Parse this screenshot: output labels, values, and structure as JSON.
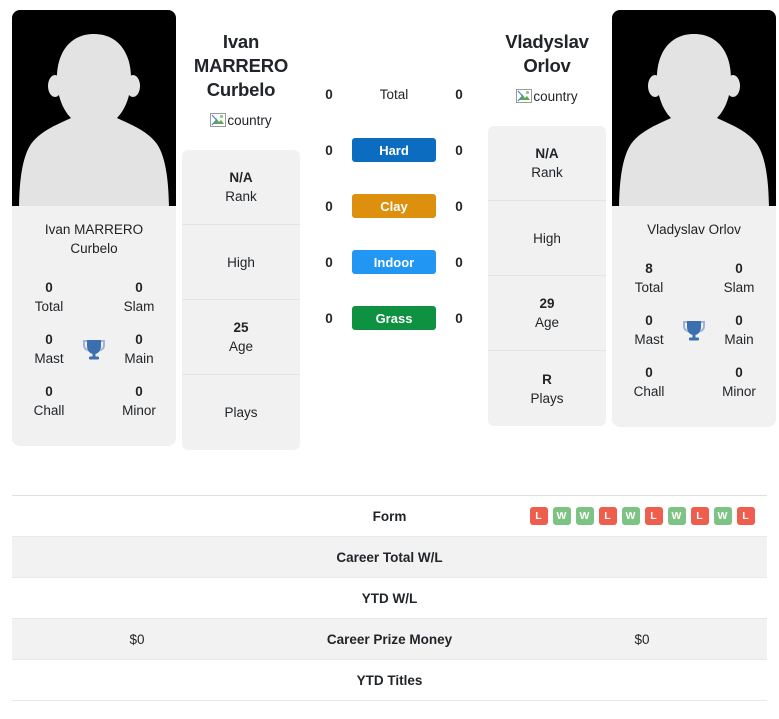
{
  "players": [
    {
      "id": "left",
      "name_line1": "Ivan MARRERO",
      "name_line2": "Curbelo",
      "photo_caption_line1": "Ivan MARRERO",
      "photo_caption_line2": "Curbelo",
      "country_alt": "country",
      "titles": {
        "total_value": "0",
        "total_label": "Total",
        "slam_value": "0",
        "slam_label": "Slam",
        "mast_value": "0",
        "mast_label": "Mast",
        "main_value": "0",
        "main_label": "Main",
        "chall_value": "0",
        "chall_label": "Chall",
        "minor_value": "0",
        "minor_label": "Minor",
        "trophy_icon": "trophy-icon"
      },
      "info": [
        {
          "value": "N/A",
          "label": "Rank"
        },
        {
          "value": "",
          "label": "High"
        },
        {
          "value": "25",
          "label": "Age"
        },
        {
          "value": "",
          "label": "Plays"
        }
      ]
    },
    {
      "id": "right",
      "name_line1": "Vladyslav",
      "name_line2": "Orlov",
      "photo_caption_line1": "Vladyslav Orlov",
      "photo_caption_line2": "",
      "country_alt": "country",
      "titles": {
        "total_value": "8",
        "total_label": "Total",
        "slam_value": "0",
        "slam_label": "Slam",
        "mast_value": "0",
        "mast_label": "Mast",
        "main_value": "0",
        "main_label": "Main",
        "chall_value": "0",
        "chall_label": "Chall",
        "minor_value": "0",
        "minor_label": "Minor",
        "trophy_icon": "trophy-icon"
      },
      "info": [
        {
          "value": "N/A",
          "label": "Rank"
        },
        {
          "value": "",
          "label": "High"
        },
        {
          "value": "29",
          "label": "Age"
        },
        {
          "value": "R",
          "label": "Plays"
        }
      ]
    }
  ],
  "surfaces": [
    {
      "label": "Total",
      "left": "0",
      "right": "0",
      "color": "transparent",
      "plain": true
    },
    {
      "label": "Hard",
      "left": "0",
      "right": "0",
      "color": "#0c6cbf",
      "plain": false
    },
    {
      "label": "Clay",
      "left": "0",
      "right": "0",
      "color": "#dd900d",
      "plain": false
    },
    {
      "label": "Indoor",
      "left": "0",
      "right": "0",
      "color": "#2196f3",
      "plain": false
    },
    {
      "label": "Grass",
      "left": "0",
      "right": "0",
      "color": "#0e9140",
      "plain": false
    }
  ],
  "table": [
    {
      "label": "Form",
      "left": "",
      "right": "",
      "striped": false,
      "type": "form"
    },
    {
      "label": "Career Total W/L",
      "left": "",
      "right": "",
      "striped": true,
      "type": "text"
    },
    {
      "label": "YTD W/L",
      "left": "",
      "right": "",
      "striped": false,
      "type": "text"
    },
    {
      "label": "Career Prize Money",
      "left": "$0",
      "right": "$0",
      "striped": true,
      "type": "text"
    },
    {
      "label": "YTD Titles",
      "left": "",
      "right": "",
      "striped": false,
      "type": "text"
    }
  ],
  "form_badges": [
    "L",
    "W",
    "W",
    "L",
    "W",
    "L",
    "W",
    "L",
    "W",
    "L"
  ],
  "colors": {
    "hard": "#0c6cbf",
    "clay": "#dd900d",
    "indoor": "#2196f3",
    "grass": "#0e9140",
    "win_badge": "#7dc383",
    "loss_badge": "#ef5d4c",
    "trophy": "#3a6fb0",
    "card_bg": "#f1f1f1"
  }
}
